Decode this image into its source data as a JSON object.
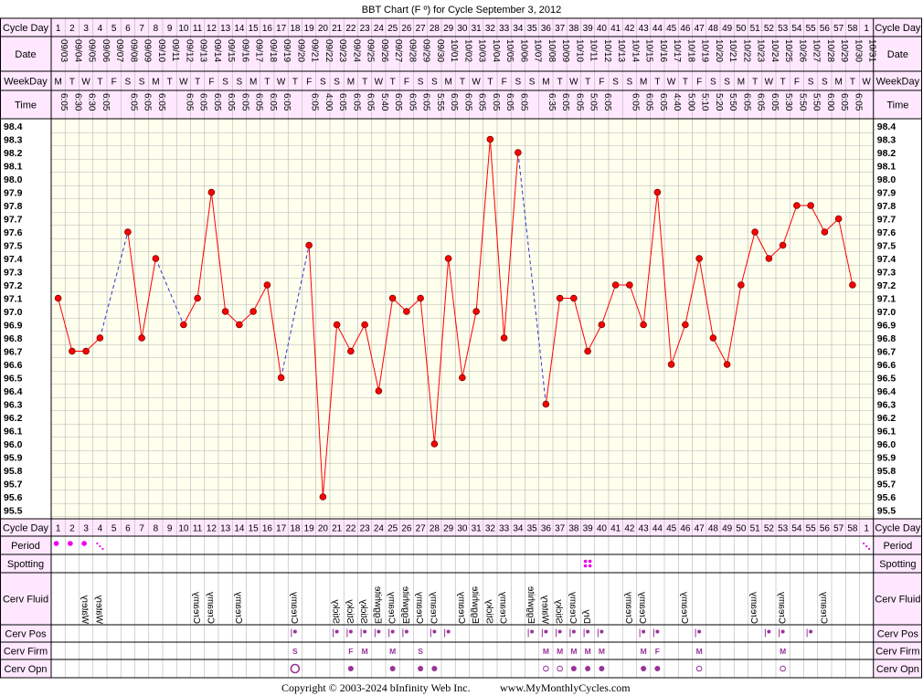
{
  "title": "BBT Chart (F º) for Cycle September 3, 2012",
  "footer": {
    "copyright": "Copyright © 2003-2024 bInfinity Web Inc.",
    "site": "www.MyMonthlyCycles.com"
  },
  "row_labels": {
    "cycle_day": "Cycle Day",
    "date": "Date",
    "weekday": "WeekDay",
    "time": "Time",
    "period": "Period",
    "spotting": "Spotting",
    "cerv_fluid": "Cerv Fluid",
    "cerv_pos": "Cerv Pos",
    "cerv_firm": "Cerv Firm",
    "cerv_opn": "Cerv Opn"
  },
  "colors": {
    "header_bg": "#ffe8ff",
    "plot_bg": "#ffffee",
    "grid": "#b4b4b4",
    "line": "#ff0000",
    "dashed_line": "#3333cc",
    "period_dot": "#ee00ee",
    "symbol": "#993399"
  },
  "chart_data": {
    "type": "line",
    "ylabel": "",
    "y_ticks": [
      "98.4",
      "98.3",
      "98.2",
      "98.1",
      "98.0",
      "97.9",
      "97.8",
      "97.7",
      "97.6",
      "97.5",
      "97.4",
      "97.3",
      "97.2",
      "97.1",
      "97.0",
      "96.9",
      "96.8",
      "96.7",
      "96.6",
      "96.5",
      "96.4",
      "96.3",
      "96.2",
      "96.1",
      "96.0",
      "95.9",
      "95.8",
      "95.7",
      "95.6",
      "95.5"
    ],
    "ylim": [
      95.5,
      98.4
    ],
    "grid": true,
    "cycle_days": [
      "1",
      "2",
      "3",
      "4",
      "5",
      "6",
      "7",
      "8",
      "9",
      "10",
      "11",
      "12",
      "13",
      "14",
      "15",
      "16",
      "17",
      "18",
      "19",
      "20",
      "21",
      "22",
      "23",
      "24",
      "25",
      "26",
      "27",
      "28",
      "29",
      "30",
      "31",
      "32",
      "33",
      "34",
      "35",
      "36",
      "37",
      "38",
      "39",
      "40",
      "41",
      "42",
      "43",
      "44",
      "45",
      "46",
      "47",
      "48",
      "49",
      "50",
      "51",
      "52",
      "53",
      "54",
      "55",
      "56",
      "57",
      "58",
      "1"
    ],
    "dates": [
      "09/03",
      "09/04",
      "09/05",
      "09/06",
      "09/07",
      "09/08",
      "09/09",
      "09/10",
      "09/11",
      "09/12",
      "09/13",
      "09/14",
      "09/15",
      "09/16",
      "09/17",
      "09/18",
      "09/19",
      "09/20",
      "09/21",
      "09/22",
      "09/23",
      "09/24",
      "09/25",
      "09/26",
      "09/27",
      "09/28",
      "09/29",
      "09/30",
      "10/01",
      "10/02",
      "10/03",
      "10/04",
      "10/05",
      "10/06",
      "10/07",
      "10/08",
      "10/09",
      "10/10",
      "10/11",
      "10/12",
      "10/13",
      "10/14",
      "10/15",
      "10/16",
      "10/17",
      "10/18",
      "10/19",
      "10/20",
      "10/21",
      "10/22",
      "10/23",
      "10/24",
      "10/25",
      "10/26",
      "10/27",
      "10/28",
      "10/29",
      "10/30",
      "10/31"
    ],
    "weekdays": [
      "M",
      "T",
      "W",
      "T",
      "F",
      "S",
      "S",
      "M",
      "T",
      "W",
      "T",
      "F",
      "S",
      "S",
      "M",
      "T",
      "W",
      "T",
      "F",
      "S",
      "S",
      "M",
      "T",
      "W",
      "T",
      "F",
      "S",
      "S",
      "M",
      "T",
      "W",
      "T",
      "F",
      "S",
      "S",
      "M",
      "T",
      "W",
      "T",
      "F",
      "S",
      "S",
      "M",
      "T",
      "W",
      "T",
      "F",
      "S",
      "S",
      "M",
      "T",
      "W",
      "T",
      "F",
      "S",
      "S",
      "M",
      "T",
      "W"
    ],
    "times": [
      "6:05",
      "6:30",
      "6:30",
      "6:05",
      "",
      "6:05",
      "6:05",
      "6:05",
      "",
      "6:05",
      "6:05",
      "6:05",
      "6:05",
      "6:05",
      "6:05",
      "6:05",
      "6:05",
      "",
      "6:05",
      "4:00",
      "6:05",
      "6:05",
      "6:05",
      "5:40",
      "6:05",
      "6:05",
      "6:05",
      "5:55",
      "6:05",
      "6:05",
      "6:05",
      "6:05",
      "6:05",
      "6:05",
      "",
      "6:35",
      "6:05",
      "6:05",
      "5:05",
      "6:05",
      "",
      "6:05",
      "6:05",
      "6:05",
      "4:40",
      "5:00",
      "5:10",
      "5:20",
      "5:50",
      "6:05",
      "6:05",
      "6:05",
      "5:30",
      "5:50",
      "5:50",
      "6:00",
      "6:05",
      "6:05",
      ""
    ],
    "temps": [
      97.1,
      96.7,
      96.7,
      96.8,
      null,
      97.6,
      96.8,
      97.4,
      null,
      96.9,
      97.1,
      97.9,
      97.0,
      96.9,
      97.0,
      97.2,
      96.5,
      null,
      97.5,
      95.6,
      96.9,
      96.7,
      96.9,
      96.4,
      97.1,
      97.0,
      97.1,
      96.0,
      97.4,
      96.5,
      97.0,
      98.3,
      96.8,
      98.2,
      null,
      96.3,
      97.1,
      97.1,
      96.7,
      96.9,
      97.2,
      97.2,
      96.9,
      97.9,
      96.6,
      96.9,
      97.4,
      96.8,
      96.6,
      97.2,
      97.6,
      97.4,
      97.5,
      97.8,
      97.8,
      97.6,
      97.7,
      97.2,
      null
    ],
    "period": [
      "dot",
      "dot",
      "dot",
      "light",
      "",
      "",
      "",
      "",
      "",
      "",
      "",
      "",
      "",
      "",
      "",
      "",
      "",
      "",
      "",
      "",
      "",
      "",
      "",
      "",
      "",
      "",
      "",
      "",
      "",
      "",
      "",
      "",
      "",
      "",
      "",
      "",
      "",
      "",
      "",
      "",
      "",
      "",
      "",
      "",
      "",
      "",
      "",
      "",
      "",
      "",
      "",
      "",
      "",
      "",
      "",
      "",
      "",
      "",
      "light"
    ],
    "spotting": [
      "",
      "",
      "",
      "",
      "",
      "",
      "",
      "",
      "",
      "",
      "",
      "",
      "",
      "",
      "",
      "",
      "",
      "",
      "",
      "",
      "",
      "",
      "",
      "",
      "",
      "",
      "",
      "",
      "",
      "",
      "",
      "",
      "",
      "",
      "",
      "",
      "",
      "",
      "spot",
      "",
      "",
      "",
      "",
      "",
      "",
      "",
      "",
      "",
      "",
      "",
      "",
      "",
      "",
      "",
      "",
      "",
      "",
      "",
      ""
    ],
    "cerv_fluid": [
      "",
      "",
      "Watery",
      "Watery",
      "",
      "",
      "",
      "",
      "",
      "",
      "Creamy",
      "Creamy",
      "",
      "Creamy",
      "",
      "",
      "",
      "Creamy",
      "",
      "",
      "Sticky",
      "Sticky",
      "Sticky",
      "Eggwhite",
      "Creamy",
      "Eggwhite",
      "Creamy",
      "Creamy",
      "",
      "Creamy",
      "Eggwhite",
      "Sticky",
      "Creamy",
      "",
      "Eggwhite",
      "Watery",
      "Sticky",
      "Creamy",
      "Dry",
      "",
      "",
      "Creamy",
      "Creamy",
      "",
      "",
      "Creamy",
      "",
      "",
      "",
      "",
      "Creamy",
      "",
      "Creamy",
      "",
      "",
      "Creamy",
      "",
      "",
      ""
    ],
    "cerv_pos": [
      "",
      "",
      "",
      "",
      "",
      "",
      "",
      "",
      "",
      "",
      "",
      "",
      "",
      "",
      "",
      "",
      "",
      "pos",
      "",
      "",
      "pos",
      "pos",
      "pos",
      "pos",
      "pos",
      "pos",
      "",
      "pos",
      "pos",
      "",
      "",
      "",
      "",
      "",
      "pos",
      "pos",
      "pos",
      "pos",
      "pos",
      "pos",
      "",
      "",
      "pos",
      "pos",
      "",
      "",
      "pos",
      "",
      "",
      "",
      "",
      "pos",
      "pos",
      "",
      "pos",
      "",
      "",
      "",
      ""
    ],
    "cerv_firm": [
      "",
      "",
      "",
      "",
      "",
      "",
      "",
      "",
      "",
      "",
      "",
      "",
      "",
      "",
      "",
      "",
      "",
      "S",
      "",
      "",
      "",
      "F",
      "M",
      "",
      "M",
      "",
      "S",
      "",
      "",
      "",
      "",
      "",
      "",
      "",
      "",
      "M",
      "M",
      "M",
      "M",
      "M",
      "",
      "",
      "M",
      "F",
      "",
      "",
      "M",
      "",
      "",
      "",
      "",
      "",
      "M",
      "",
      "",
      "",
      "",
      "",
      ""
    ],
    "cerv_opn": [
      "",
      "",
      "",
      "",
      "",
      "",
      "",
      "",
      "",
      "",
      "",
      "",
      "",
      "",
      "",
      "",
      "",
      "O",
      "",
      "",
      "",
      "c",
      "",
      "",
      "c",
      "",
      "c",
      "c",
      "",
      "",
      "",
      "",
      "",
      "",
      "",
      "o",
      "o",
      "c",
      "c",
      "c",
      "",
      "",
      "c",
      "c",
      "",
      "",
      "o",
      "",
      "",
      "",
      "",
      "",
      "o",
      "",
      "",
      "",
      "",
      "",
      ""
    ]
  }
}
